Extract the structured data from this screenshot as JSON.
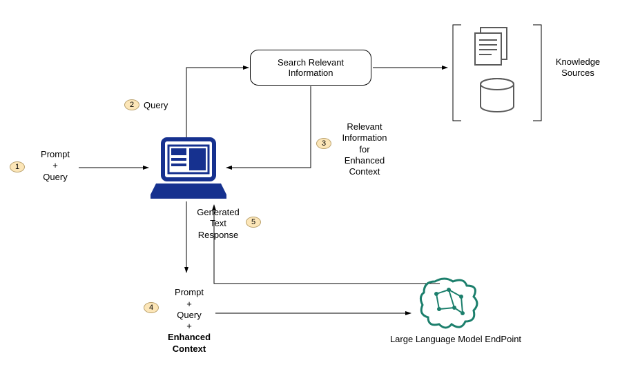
{
  "nodes": {
    "search": {
      "line1": "Search Relevant",
      "line2": "Information"
    },
    "knowledge_label": "Knowledge\nSources",
    "llm_label": "Large Language Model EndPoint"
  },
  "steps": {
    "s1": {
      "num": "1",
      "label": "Prompt\n+\nQuery"
    },
    "s2": {
      "num": "2",
      "label": "Query"
    },
    "s3": {
      "num": "3",
      "label": "Relevant\nInformation\nfor\nEnhanced\nContext"
    },
    "s4": {
      "num": "4",
      "label_plain": "Prompt\n+\nQuery\n+",
      "label_bold": "Enhanced\nContext"
    },
    "s5": {
      "num": "5",
      "label": "Generated\nText\nResponse"
    }
  }
}
